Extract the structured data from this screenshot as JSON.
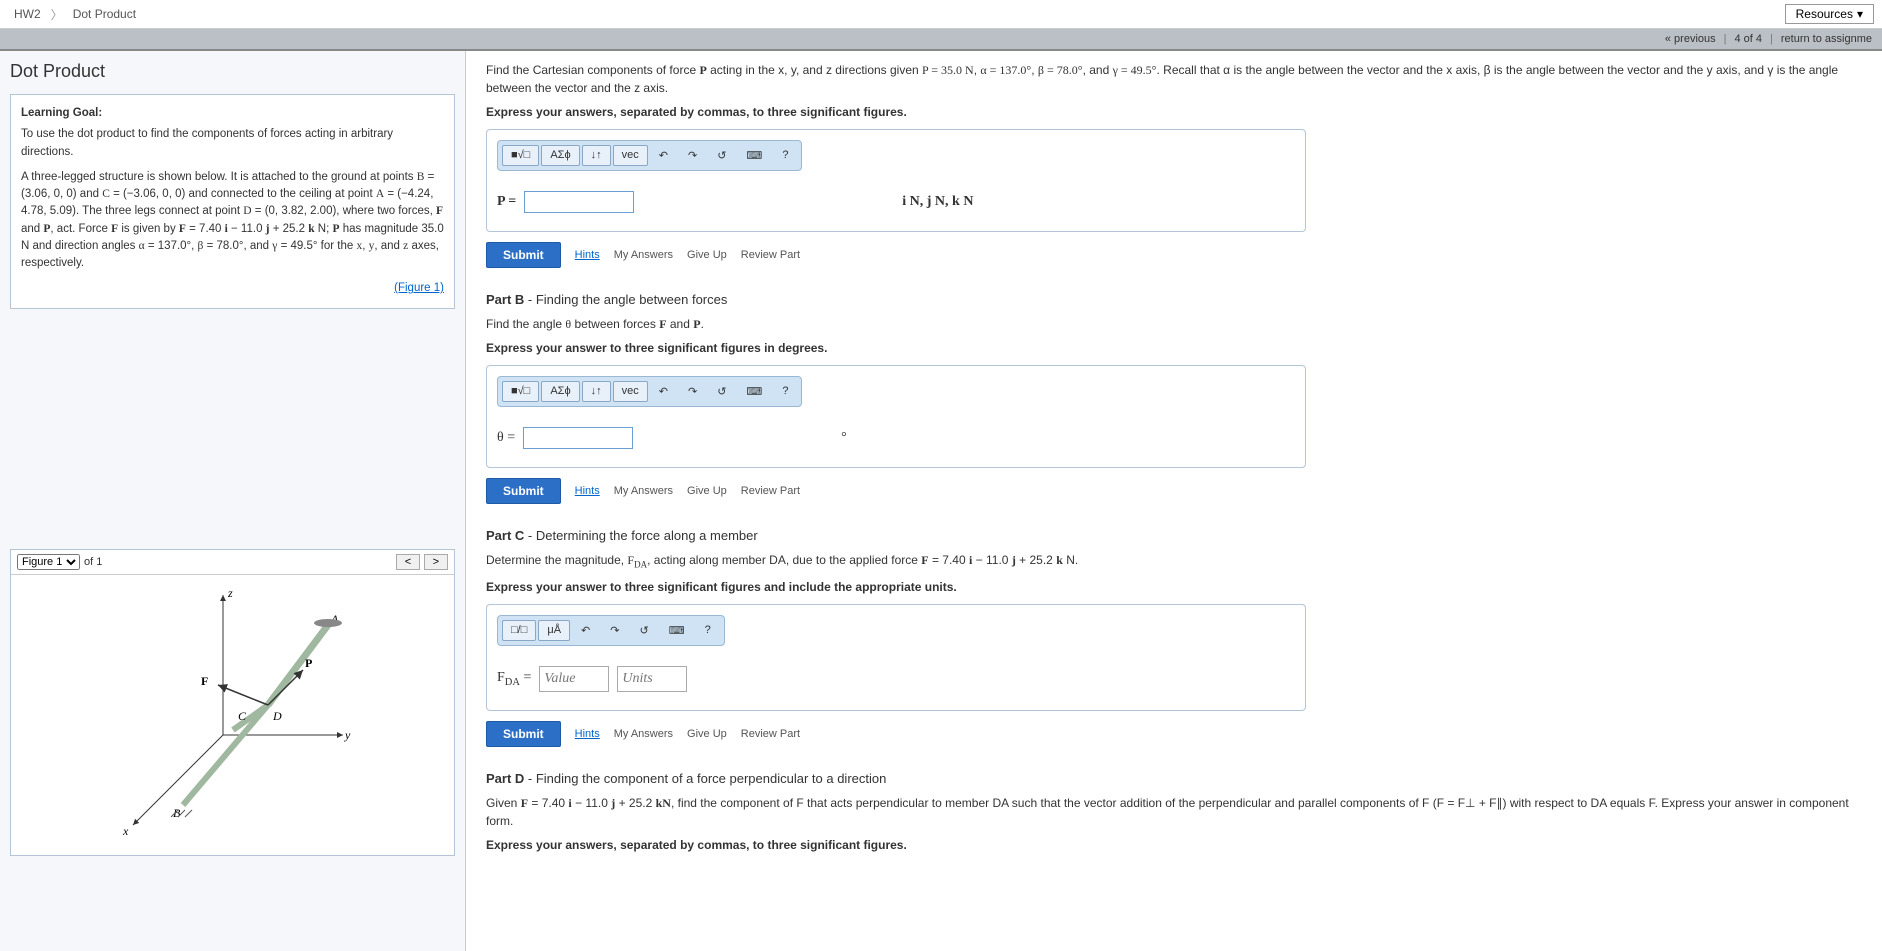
{
  "breadcrumb": {
    "hw": "HW2",
    "title": "Dot Product"
  },
  "resources_label": "Resources",
  "nav": {
    "prev": "« previous",
    "pos": "4 of 4",
    "return": "return to assignme"
  },
  "page_title": "Dot Product",
  "learning_goal": {
    "heading": "Learning Goal:",
    "text": "To use the dot product to find the components of forces acting in arbitrary directions.",
    "figure_link": "(Figure 1)"
  },
  "figure": {
    "selector": "Figure 1",
    "of": "of 1",
    "prev": "<",
    "next": ">"
  },
  "toolbar": {
    "templates": "■√□",
    "greek": "ΑΣϕ",
    "scripts": "↓↑",
    "vec": "vec",
    "undo": "↶",
    "redo": "↷",
    "reset": "↺",
    "keyboard": "⌨",
    "help": "?",
    "units_btn": "μÅ",
    "frac_btn": "□/□"
  },
  "partA": {
    "prompt_pre": "Find the Cartesian components of force ",
    "P": "P",
    "prompt_mid": " acting in the x, y, and z directions given ",
    "eqP": "P = 35.0 N",
    "eqA": "α = 137.0°",
    "eqB": "β = 78.0°",
    "eqG": "γ = 49.5°",
    "prompt_tail": ". Recall that α is the angle between the vector and the x axis, β is the angle between the vector and the y axis, and γ is the angle between the vector and the z axis.",
    "instr": "Express your answers, separated by commas, to three significant figures.",
    "lhs": "P =",
    "units": "i N, j N, k N"
  },
  "partB": {
    "header_label": "Part B",
    "header_desc": " - Finding the angle between forces",
    "prompt": "Find the angle θ between forces F and P.",
    "instr": "Express your answer to three significant figures in degrees.",
    "lhs": "θ =",
    "units": "°"
  },
  "partC": {
    "header_label": "Part C",
    "header_desc": " - Determining the force along a member",
    "prompt_pre": "Determine the magnitude, ",
    "FDA": "F",
    "FDA_sub": "DA",
    "prompt_mid": ", acting along member DA, due to the applied force ",
    "eqF": "F = 7.40 i − 11.0 j + 25.2 k N",
    "instr": "Express your answer to three significant figures and include the appropriate units.",
    "lhs_pre": "F",
    "lhs_sub": "DA",
    "lhs_post": " =",
    "value_ph": "Value",
    "units_ph": "Units"
  },
  "partD": {
    "header_label": "Part D",
    "header_desc": " - Finding the component of a force perpendicular to a direction",
    "prompt_pre": "Given ",
    "eqF": "F = 7.40 i  − 11.0 j  + 25.2 kN",
    "prompt_mid": ", find the component of F that acts perpendicular to member DA such that the vector addition of the perpendicular and parallel components of F (F = F⊥ + F∥) with respect to DA equals F. Express your answer in component form.",
    "instr": "Express your answers, separated by commas, to three significant figures."
  },
  "actions": {
    "submit": "Submit",
    "hints": "Hints",
    "my_answers": "My Answers",
    "give_up": "Give Up",
    "review": "Review Part"
  }
}
